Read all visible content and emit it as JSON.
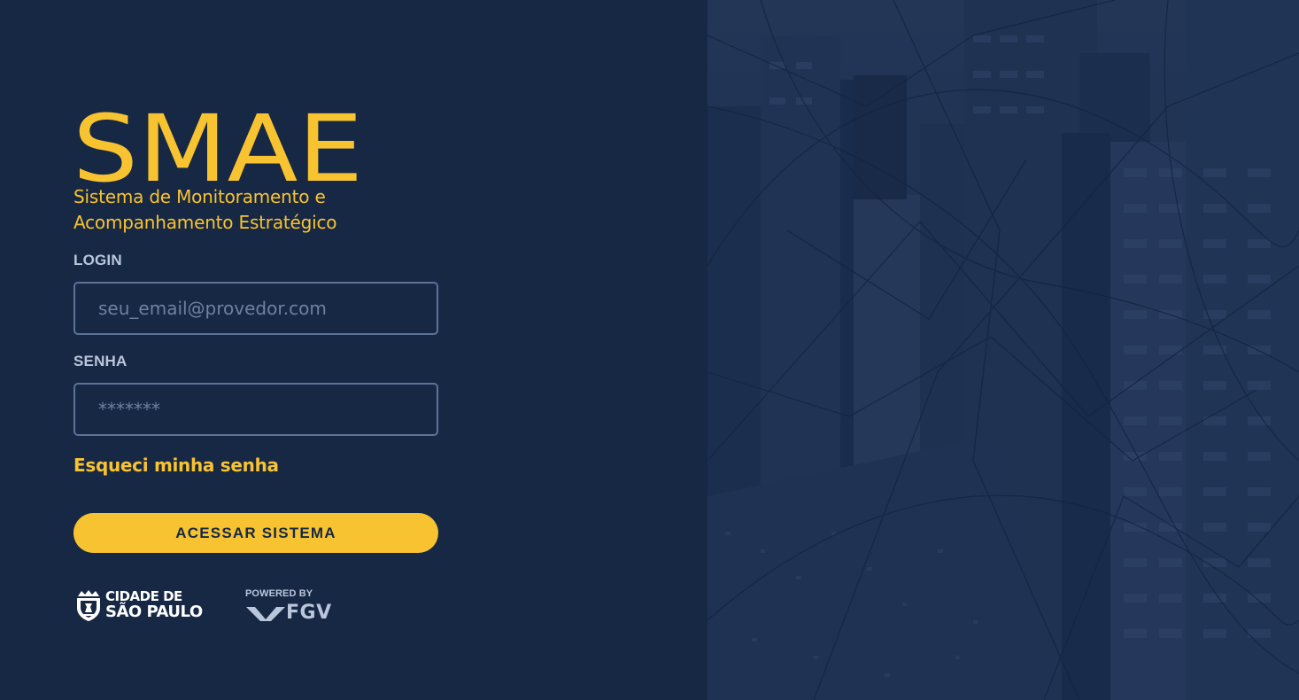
{
  "brand": {
    "logo_text": "SMAE",
    "subtitle_line1": "Sistema de Monitoramento e",
    "subtitle_line2": "Acompanhamento Estratégico",
    "accent_color": "#f8c330",
    "background_color": "#172845"
  },
  "login_form": {
    "login_label": "LOGIN",
    "login_placeholder": "seu_email@provedor.com",
    "login_value": "",
    "password_label": "SENHA",
    "password_placeholder": "*******",
    "password_value": "",
    "forgot_password_link": "Esqueci minha senha",
    "submit_button": "ACESSAR SISTEMA"
  },
  "footer": {
    "city_logo_line1": "CIDADE DE",
    "city_logo_line2": "SÃO PAULO",
    "powered_by": "POWERED BY",
    "fgv_logo_text": "FGV",
    "city_emblem_icon": "sao-paulo-coat-of-arms-icon",
    "fgv_icon": "fgv-chevron-icon"
  },
  "background_image": {
    "description_icon": "city-buildings-image"
  }
}
